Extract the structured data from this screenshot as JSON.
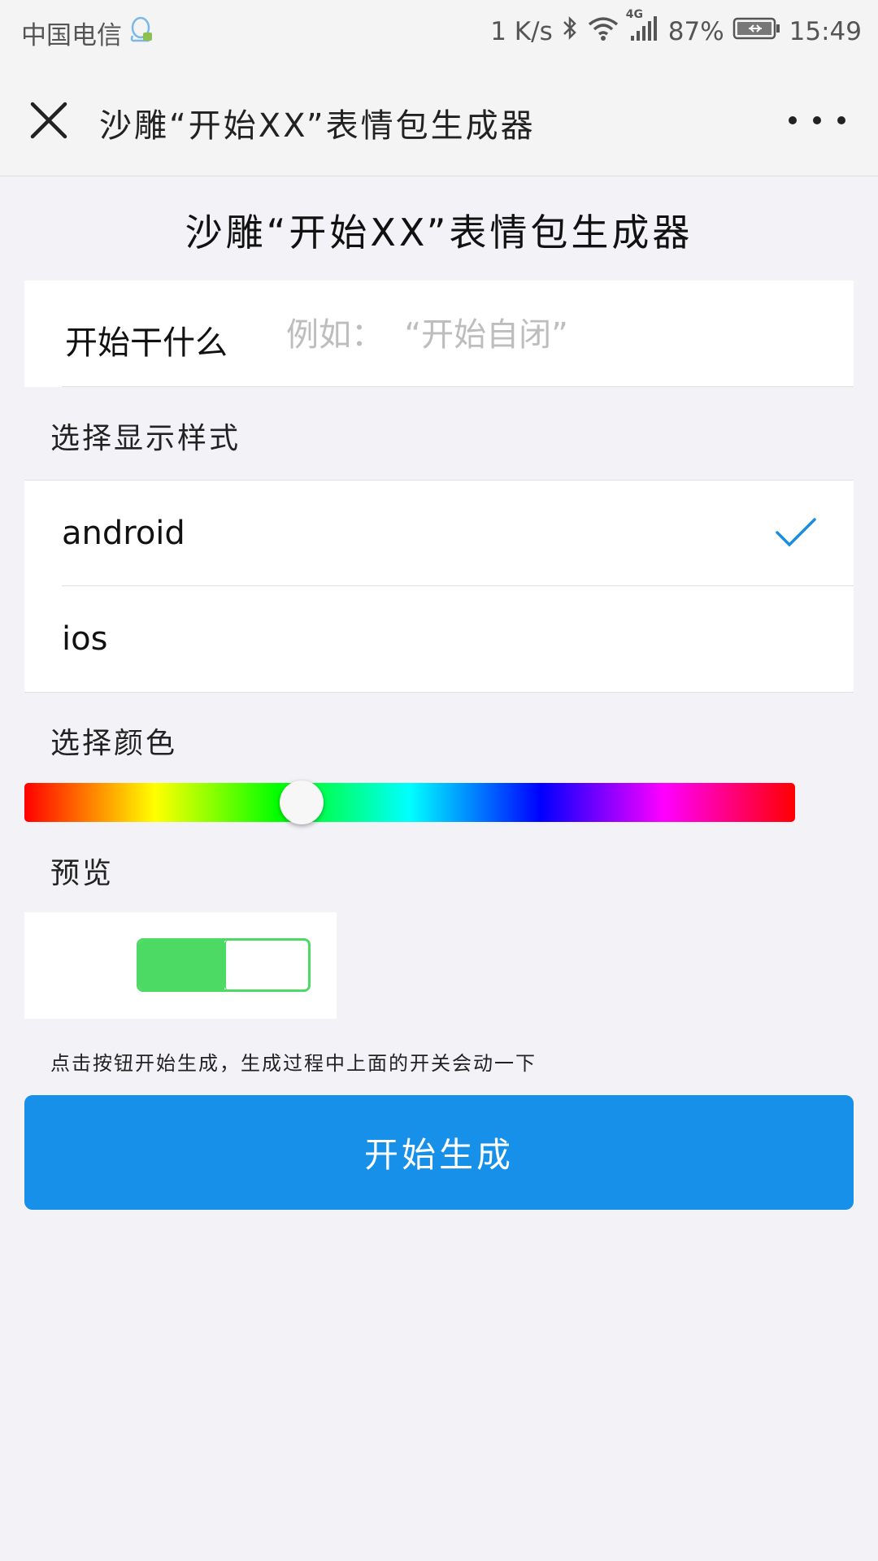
{
  "status_bar": {
    "carrier": "中国电信",
    "network_speed": "1 K/s",
    "network_type": "4G",
    "battery": "87%",
    "time": "15:49"
  },
  "navbar": {
    "title": "沙雕“开始XX”表情包生成器"
  },
  "page": {
    "title": "沙雕“开始XX”表情包生成器",
    "input": {
      "label": "开始干什么",
      "placeholder": "例如：  “开始自闭”",
      "value": ""
    },
    "style_section": {
      "label": "选择显示样式",
      "options": [
        {
          "label": "android",
          "selected": true
        },
        {
          "label": "ios",
          "selected": false
        }
      ]
    },
    "color_section": {
      "label": "选择颜色",
      "slider_value": 0.36
    },
    "preview_section": {
      "label": "预览",
      "switch_fill": 0.5,
      "switch_color": "#4cd964"
    },
    "hint": "点击按钮开始生成，生成过程中上面的开关会动一下",
    "generate_button": "开始生成"
  },
  "colors": {
    "accent": "#1690e8",
    "check": "#1a8ce2",
    "switch_green": "#4cd964"
  }
}
